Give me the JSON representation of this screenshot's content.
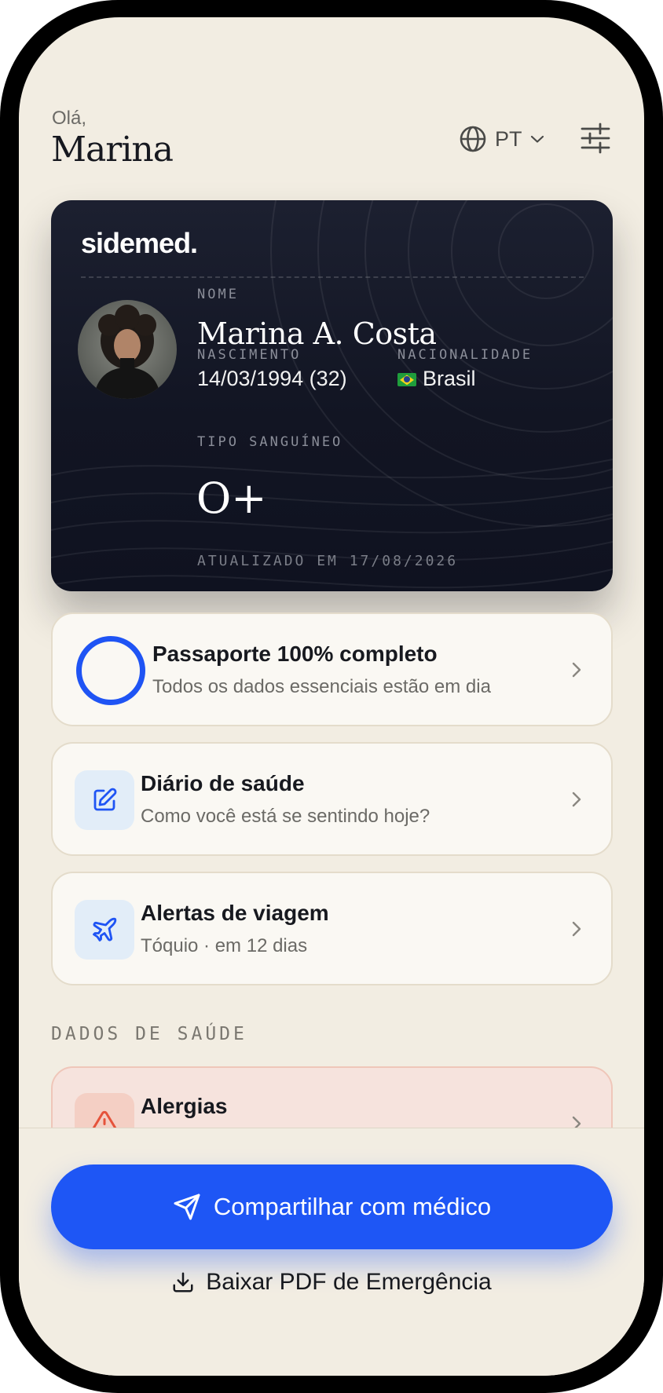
{
  "header": {
    "greeting": "Olá,",
    "user_name": "Marina",
    "language": "PT"
  },
  "id_card": {
    "brand": "sidemed.",
    "name_label": "NOME",
    "name": "Marina A. Costa",
    "birth_label": "NASCIMENTO",
    "birth": "14/03/1994 (32)",
    "nationality_label": "NACIONALIDADE",
    "nationality": "Brasil",
    "blood_label": "TIPO SANGUÍNEO",
    "blood_type": "O+",
    "updated": "ATUALIZADO EM 17/08/2026"
  },
  "cards": {
    "passport": {
      "title": "Passaporte 100% completo",
      "subtitle": "Todos os dados essenciais estão em dia",
      "progress_percent": 100
    },
    "diary": {
      "title": "Diário de saúde",
      "subtitle": "Como você está se sentindo hoje?"
    },
    "travel": {
      "title": "Alertas de viagem",
      "subtitle": "Tóquio · em 12 dias"
    }
  },
  "health_section": {
    "heading": "DADOS DE SAÚDE",
    "allergies_title": "Alergias"
  },
  "actions": {
    "share_label": "Compartilhar com médico",
    "pdf_label": "Baixar PDF de Emergência"
  },
  "colors": {
    "accent": "#1e56f5",
    "background": "#f2ede2",
    "card_dark": "#121523",
    "alert_bg": "#f6e3dd",
    "alert_icon": "#e5533b"
  },
  "icons": {
    "language": "globe-icon",
    "language_dropdown": "chevron-down-icon",
    "settings": "sliders-icon",
    "diary": "edit-icon",
    "travel": "airplane-icon",
    "allergies": "warning-icon",
    "row_arrow": "chevron-right-icon",
    "share": "send-icon",
    "pdf": "download-icon"
  }
}
